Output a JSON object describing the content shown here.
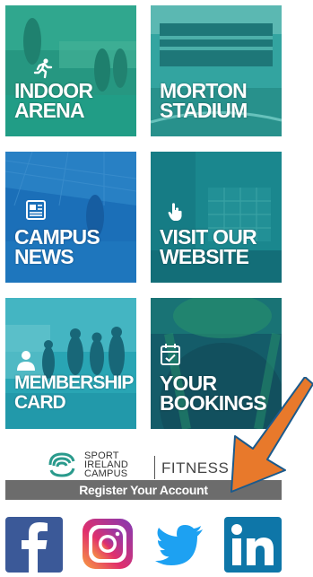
{
  "tiles": {
    "indoor_arena": {
      "label": "INDOOR\nARENA",
      "icon": "runner-icon"
    },
    "morton_stadium": {
      "label": "MORTON\nSTADIUM"
    },
    "campus_news": {
      "label": "CAMPUS\nNEWS",
      "icon": "newspaper-icon"
    },
    "visit_website": {
      "label": "VISIT OUR\nWEBSITE",
      "icon": "hand-pointer-icon"
    },
    "membership_card": {
      "label": "MEMBERSHIP\nCARD",
      "icon": "person-icon"
    },
    "your_bookings": {
      "label": "YOUR\nBOOKINGS",
      "icon": "calendar-check-icon"
    }
  },
  "partner": {
    "sport_text": "SPORT\nIRELAND\nCAMPUS",
    "fitness_text": "FITNESS",
    "register_label": "Register Your Account"
  },
  "social": [
    "facebook-icon",
    "instagram-icon",
    "twitter-icon",
    "linkedin-icon"
  ],
  "colors": {
    "teal_tint": "#1fa58d",
    "blue_tint": "#1b6fb8",
    "dark_teal": "#145e6b",
    "arrow": "#e8792b",
    "register_bar": "#6c6c6c",
    "facebook": "#3b5998",
    "twitter": "#1da1f2",
    "linkedin": "#0e76a8"
  }
}
